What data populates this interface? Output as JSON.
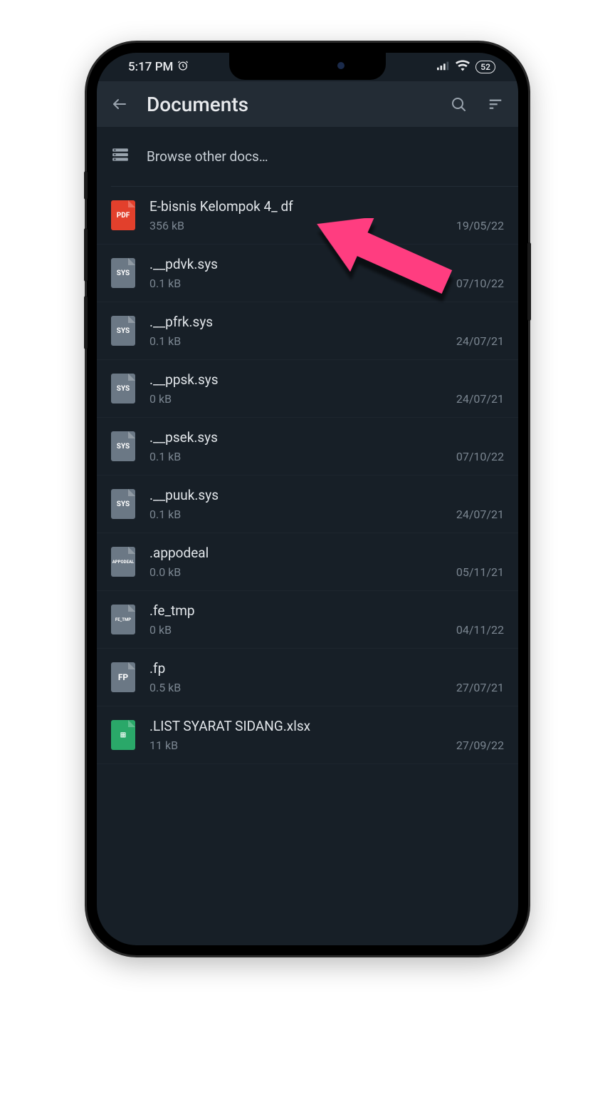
{
  "status_bar": {
    "time": "5:17 PM",
    "alarm_icon": "alarm",
    "signal_icon": "signal",
    "wifi_icon": "wifi",
    "battery_percent": "52"
  },
  "app_bar": {
    "back_icon": "arrow-left",
    "title": "Documents",
    "search_icon": "search",
    "sort_icon": "sort-lines"
  },
  "browse": {
    "label": "Browse other docs…",
    "icon": "storage"
  },
  "files": [
    {
      "name": " E-bisnis Kelompok 4_           df",
      "size": "356 kB",
      "date": "19/05/22",
      "type": "pdf",
      "badge": "PDF"
    },
    {
      "name": ".__pdvk.sys",
      "size": "0.1 kB",
      "date": "07/10/22",
      "type": "sys",
      "badge": "SYS"
    },
    {
      "name": ".__pfrk.sys",
      "size": "0.1 kB",
      "date": "24/07/21",
      "type": "sys",
      "badge": "SYS"
    },
    {
      "name": ".__ppsk.sys",
      "size": "0 kB",
      "date": "24/07/21",
      "type": "sys",
      "badge": "SYS"
    },
    {
      "name": ".__psek.sys",
      "size": "0.1 kB",
      "date": "07/10/22",
      "type": "sys",
      "badge": "SYS"
    },
    {
      "name": ".__puuk.sys",
      "size": "0.1 kB",
      "date": "24/07/21",
      "type": "sys",
      "badge": "SYS"
    },
    {
      "name": ".appodeal",
      "size": "0.0 kB",
      "date": "05/11/21",
      "type": "generic",
      "badge": "APPODEAL"
    },
    {
      "name": ".fe_tmp",
      "size": "0 kB",
      "date": "04/11/22",
      "type": "generic",
      "badge": "FE_TMP"
    },
    {
      "name": ".fp",
      "size": "0.5 kB",
      "date": "27/07/21",
      "type": "fp",
      "badge": "FP"
    },
    {
      "name": ".LIST SYARAT SIDANG.xlsx",
      "size": "11 kB",
      "date": "27/09/22",
      "type": "xlsx",
      "badge": "⊞"
    }
  ],
  "annotation": {
    "arrow_color": "#ff3e80"
  }
}
